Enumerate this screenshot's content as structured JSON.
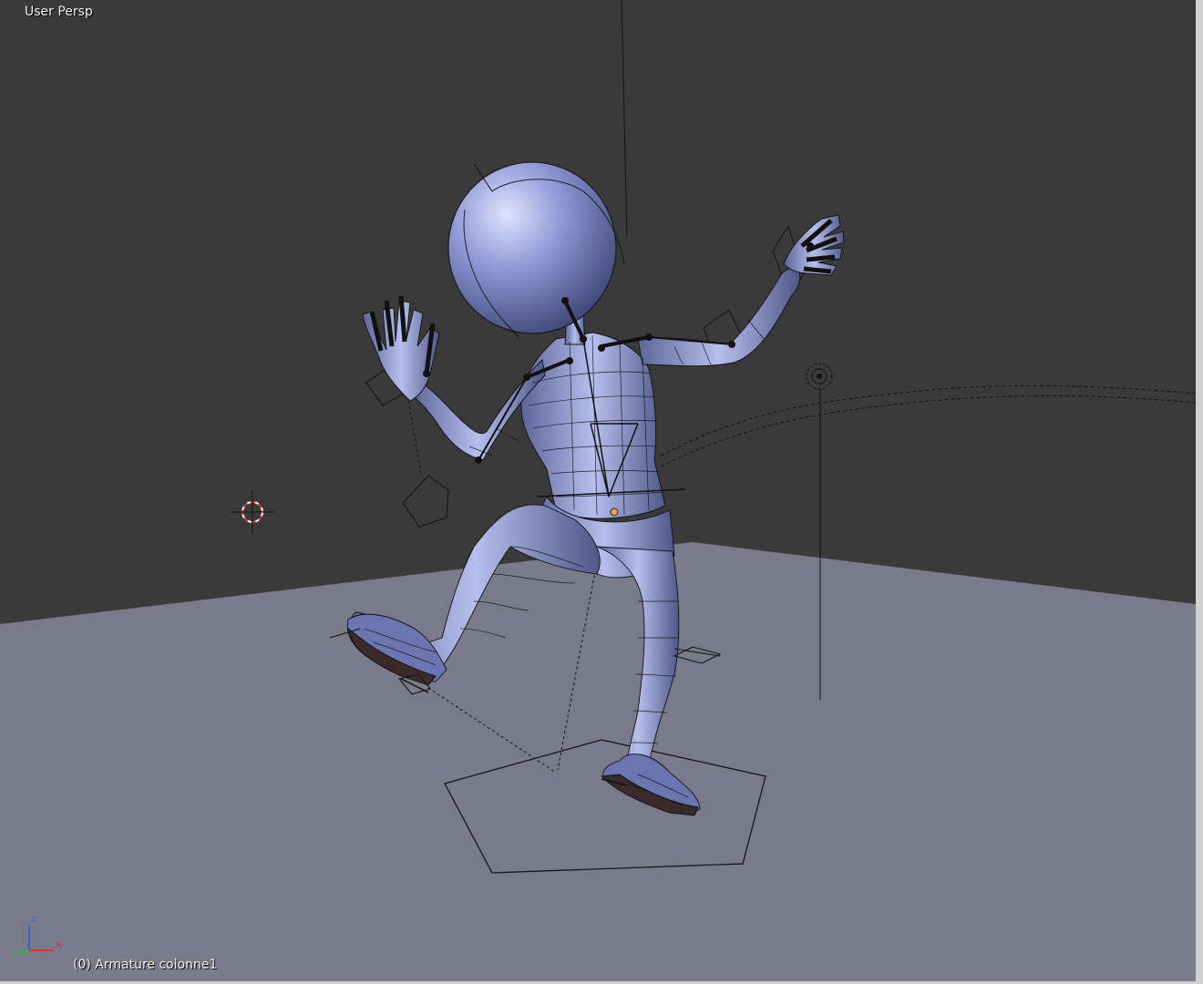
{
  "viewport": {
    "view_name": "User Persp",
    "object_info": "(0) Armature colonne1"
  },
  "axes": {
    "x": "x",
    "y": "y",
    "z": "z"
  },
  "colors": {
    "background": "#3a3a3a",
    "floor": "#7a7a8a",
    "mesh": "#7a86c0",
    "wire": "#111111",
    "x_axis": "#e03030",
    "y_axis": "#30c030",
    "z_axis": "#3060e0"
  }
}
